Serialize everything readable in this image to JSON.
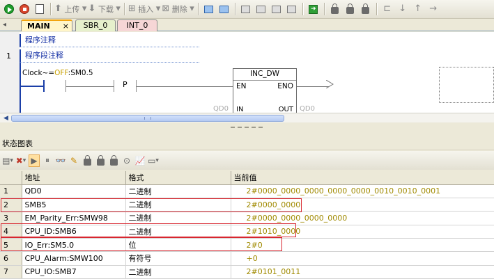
{
  "toolbar": {
    "upload_label": "上传",
    "download_label": "下载",
    "insert_label": "插入",
    "delete_label": "删除"
  },
  "tabs": [
    {
      "label": "MAIN",
      "close": "×"
    },
    {
      "label": "SBR_0"
    },
    {
      "label": "INT_0"
    }
  ],
  "editor": {
    "program_comment": "程序注释",
    "network_number": "1",
    "network_comment": "程序段注释",
    "contact": {
      "prefix": "Clock~=",
      "state": "OFF",
      "address": ":SM0.5"
    },
    "p_contact": "P",
    "block": {
      "name": "INC_DW",
      "en": "EN",
      "eno": "ENO",
      "in": "IN",
      "out": "OUT",
      "in_operand": "QD0",
      "out_operand": "QD0",
      "in_marker": "QD0",
      "out_marker": "QD0"
    }
  },
  "status_chart": {
    "title": "状态图表",
    "headers": [
      "",
      "地址",
      "格式",
      "当前值"
    ],
    "rows": [
      {
        "n": "1",
        "address": "QD0",
        "format": "二进制",
        "value": "2#0000_0000_0000_0000_0000_0010_0010_0001"
      },
      {
        "n": "2",
        "address": "SMB5",
        "format": "二进制",
        "value": "2#0000_0000"
      },
      {
        "n": "3",
        "address": "EM_Parity_Err:SMW98",
        "format": "二进制",
        "value": "2#0000_0000_0000_0000"
      },
      {
        "n": "4",
        "address": "CPU_ID:SMB6",
        "format": "二进制",
        "value": "2#1010_0000"
      },
      {
        "n": "5",
        "address": "IO_Err:SM5.0",
        "format": "位",
        "value": "2#0"
      },
      {
        "n": "6",
        "address": "CPU_Alarm:SMW100",
        "format": "有符号",
        "value": "+0"
      },
      {
        "n": "7",
        "address": "CPU_IO:SMB7",
        "format": "二进制",
        "value": "2#0101_0011"
      }
    ]
  },
  "colors": {
    "rail_blue": "#1b3fa8",
    "value_text": "#a08a00",
    "highlight_red": "#d8262f",
    "tab_main": "#fff5c8",
    "tab_sbr": "#e6f0cc",
    "tab_int": "#f6d6d6"
  },
  "icons": [
    "run-icon",
    "stop-icon",
    "edit-doc-icon",
    "upload-icon",
    "download-icon",
    "insert-icon",
    "delete-icon",
    "lock-icon"
  ]
}
